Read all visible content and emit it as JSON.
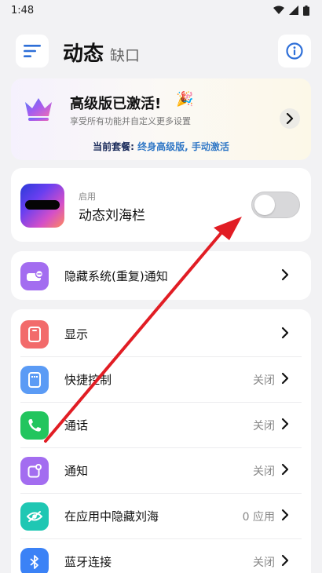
{
  "status_bar": {
    "time": "1:48"
  },
  "header": {
    "title": "动态",
    "subtitle": "缺口"
  },
  "premium": {
    "title": "高级版已激活!",
    "emoji": "🎉",
    "subtitle": "享受所有功能并自定义更多设置",
    "plan_label": "当前套餐:",
    "plan_value": "终身高级版, 手动激活"
  },
  "notch": {
    "label": "启用",
    "title": "动态刘海栏",
    "enabled": false
  },
  "hide_notifications": {
    "label": "隐藏系统(重复)通知"
  },
  "settings": [
    {
      "label": "显示",
      "value": "",
      "icon": "display-icon",
      "color": "#f26b6b"
    },
    {
      "label": "快捷控制",
      "value": "关闭",
      "icon": "quick-control-icon",
      "color": "#5b9bf5"
    },
    {
      "label": "通话",
      "value": "关闭",
      "icon": "phone-icon",
      "color": "#22c55e"
    },
    {
      "label": "通知",
      "value": "关闭",
      "icon": "notification-icon",
      "color": "#a36df0"
    },
    {
      "label": "在应用中隐藏刘海",
      "value": "0 应用",
      "icon": "eye-off-icon",
      "color": "#1fc7b3"
    },
    {
      "label": "蓝牙连接",
      "value": "关闭",
      "icon": "bluetooth-icon",
      "color": "#3b82f6"
    }
  ],
  "colors": {
    "accent": "#3178c6",
    "arrow": "#e11d24",
    "background": "#f2f2f4"
  }
}
